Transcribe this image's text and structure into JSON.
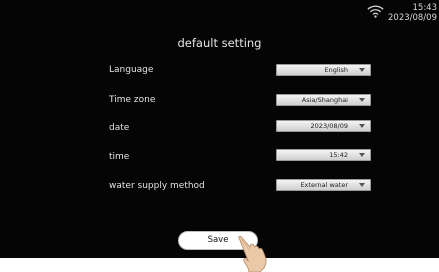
{
  "status": {
    "time": "15:43",
    "date": "2023/08/09"
  },
  "title": "default setting",
  "settings": [
    {
      "label": "Language",
      "value": "English"
    },
    {
      "label": "Time zone",
      "value": "Asia/Shanghai"
    },
    {
      "label": "date",
      "value": "2023/08/09"
    },
    {
      "label": "time",
      "value": "15:42"
    },
    {
      "label": "water supply method",
      "value": "External water"
    }
  ],
  "save_label": "Save",
  "icons": [
    "wifi-icon",
    "dropdown-arrow-icon",
    "pointing-hand-icon"
  ]
}
